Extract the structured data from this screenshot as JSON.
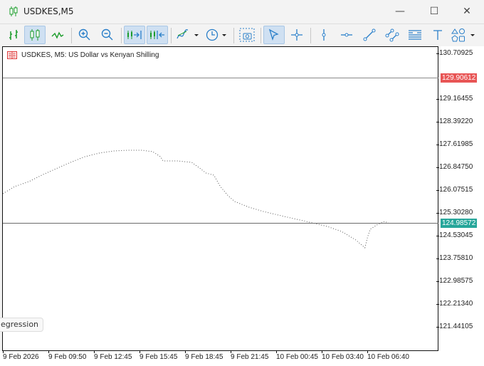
{
  "window": {
    "title": "USDKES,M5",
    "minimize": "—",
    "maximize": "☐",
    "close": "✕"
  },
  "toolbar": {
    "items": [
      "bar-chart-icon",
      "candlestick-chart-icon",
      "line-chart-icon",
      "zoom-in-icon",
      "zoom-out-icon",
      "autoscroll-icon",
      "chart-shift-icon",
      "indicators-icon",
      "timeframe-icon",
      "screenshot-icon",
      "cursor-icon",
      "crosshair-icon",
      "vertical-line-icon",
      "horizontal-line-icon",
      "trendline-icon",
      "channel-icon",
      "fibonacci-icon",
      "text-icon",
      "shapes-icon"
    ]
  },
  "chart": {
    "label": "USDKES, M5:  US Dollar vs Kenyan Shilling",
    "price_ticks": [
      "130.70925",
      "129.16455",
      "128.39220",
      "127.61985",
      "126.84750",
      "126.07515",
      "125.30280",
      "124.53045",
      "123.75810",
      "122.98575",
      "122.21340",
      "121.44105"
    ],
    "price_range": [
      121.44105,
      130.70925
    ],
    "ask_line": {
      "price": 129.90612,
      "label": "129.90612",
      "color": "#e85555"
    },
    "bid_line": {
      "price": 124.98572,
      "label": "124.98572",
      "color": "#26a69a"
    },
    "time_ticks": [
      "9 Feb 2026",
      "9 Feb 09:50",
      "9 Feb 12:45",
      "9 Feb 15:45",
      "9 Feb 18:45",
      "9 Feb 21:45",
      "10 Feb 00:45",
      "10 Feb 03:40",
      "10 Feb 06:40"
    ],
    "series_bars": [
      0,
      9,
      20,
      31,
      42,
      52,
      63,
      74,
      85,
      96,
      107,
      115,
      121,
      123,
      134,
      145,
      151,
      156,
      162,
      167,
      173,
      178,
      189,
      200,
      216,
      233,
      249,
      260,
      271,
      278,
      280,
      282,
      287,
      293,
      296
    ],
    "series_prices": [
      125.979,
      126.22,
      126.389,
      126.63,
      126.848,
      127.041,
      127.234,
      127.355,
      127.427,
      127.451,
      127.451,
      127.403,
      127.234,
      127.089,
      127.089,
      127.041,
      126.848,
      126.679,
      126.606,
      126.22,
      125.906,
      125.713,
      125.52,
      125.375,
      125.206,
      125.037,
      124.868,
      124.699,
      124.41,
      124.145,
      124.506,
      124.772,
      124.917,
      125.037,
      124.989
    ],
    "regression_tag": "egression"
  }
}
